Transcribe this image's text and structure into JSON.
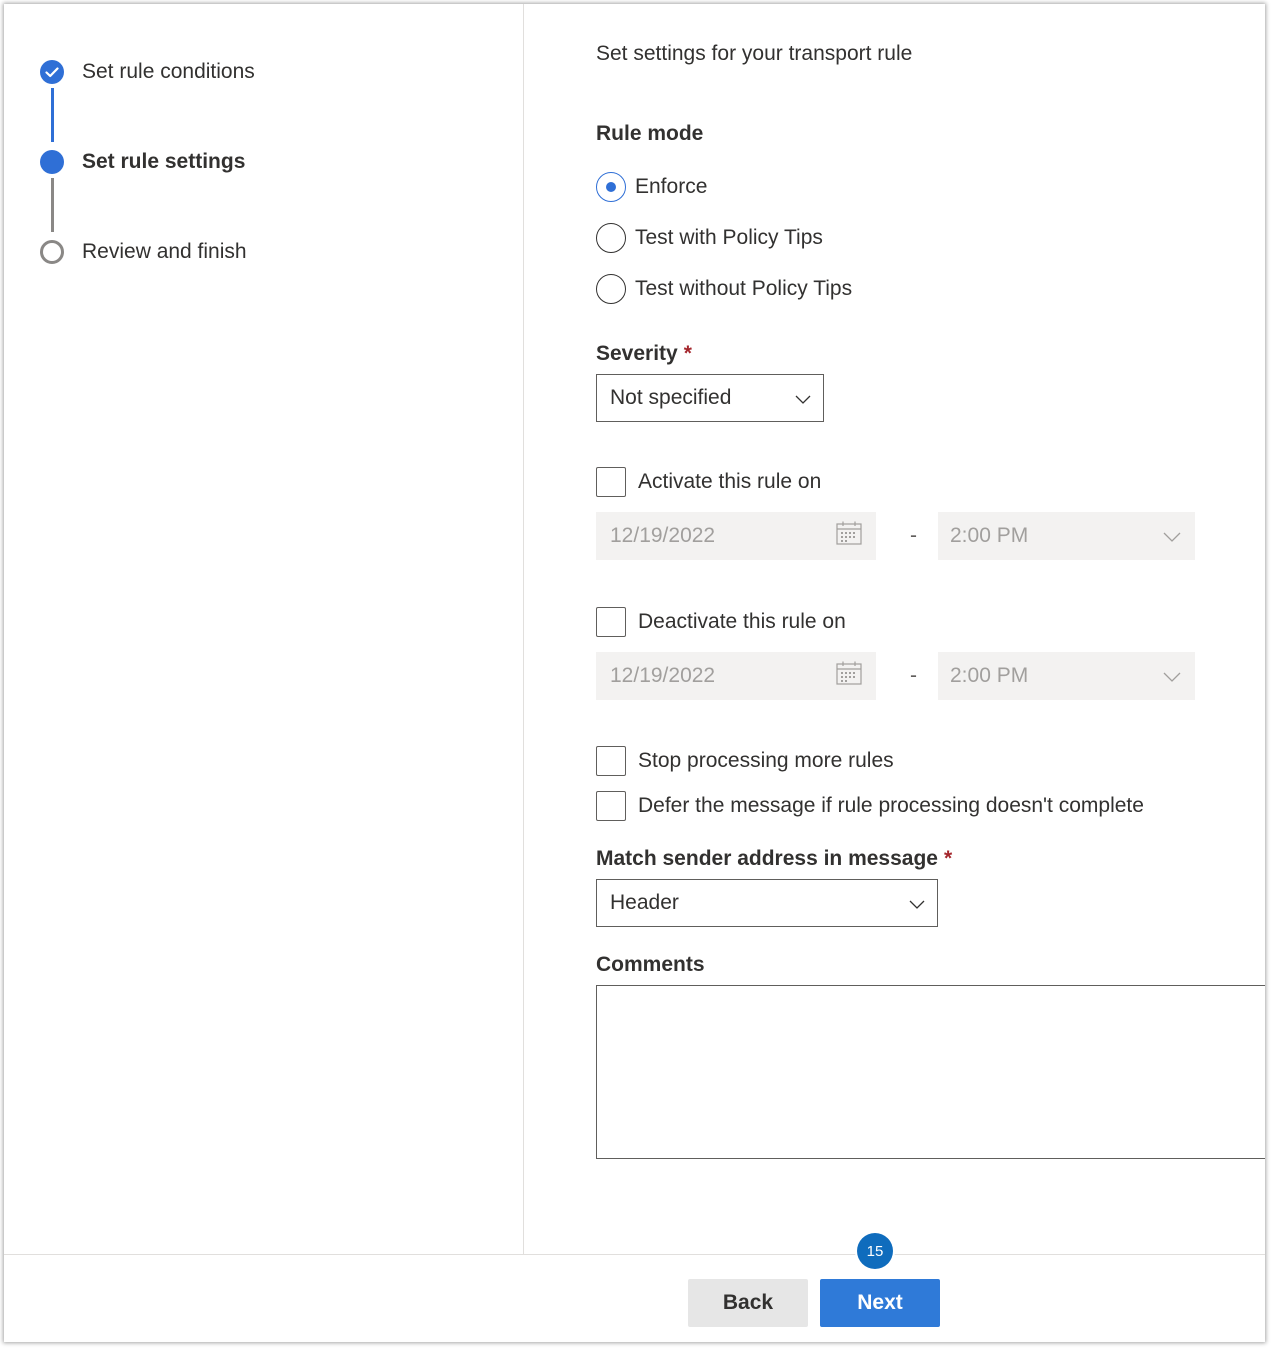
{
  "wizard": {
    "steps": [
      {
        "label": "Set rule conditions",
        "state": "completed"
      },
      {
        "label": "Set rule settings",
        "state": "current"
      },
      {
        "label": "Review and finish",
        "state": "upcoming"
      }
    ]
  },
  "form": {
    "intro": "Set settings for your transport rule",
    "rule_mode": {
      "label": "Rule mode",
      "options": [
        "Enforce",
        "Test with Policy Tips",
        "Test without Policy Tips"
      ],
      "selected": "Enforce"
    },
    "severity": {
      "label": "Severity",
      "required_mark": "*",
      "value": "Not specified"
    },
    "activate": {
      "label": "Activate this rule on",
      "date": "12/19/2022",
      "time": "2:00 PM",
      "separator": "-",
      "checked": false
    },
    "deactivate": {
      "label": "Deactivate this rule on",
      "date": "12/19/2022",
      "time": "2:00 PM",
      "separator": "-",
      "checked": false
    },
    "stop_processing": {
      "label": "Stop processing more rules",
      "checked": false
    },
    "defer": {
      "label": "Defer the message if rule processing doesn't complete",
      "checked": false
    },
    "match_sender": {
      "label": "Match sender address in message",
      "required_mark": "*",
      "value": "Header"
    },
    "comments": {
      "label": "Comments",
      "value": ""
    }
  },
  "footer": {
    "back_label": "Back",
    "next_label": "Next",
    "step_badge": "15"
  },
  "colors": {
    "accent": "#2f6fd6",
    "primary_button": "#2f7ad8",
    "required": "#a4262c",
    "disabled_bg": "#f3f2f1"
  }
}
